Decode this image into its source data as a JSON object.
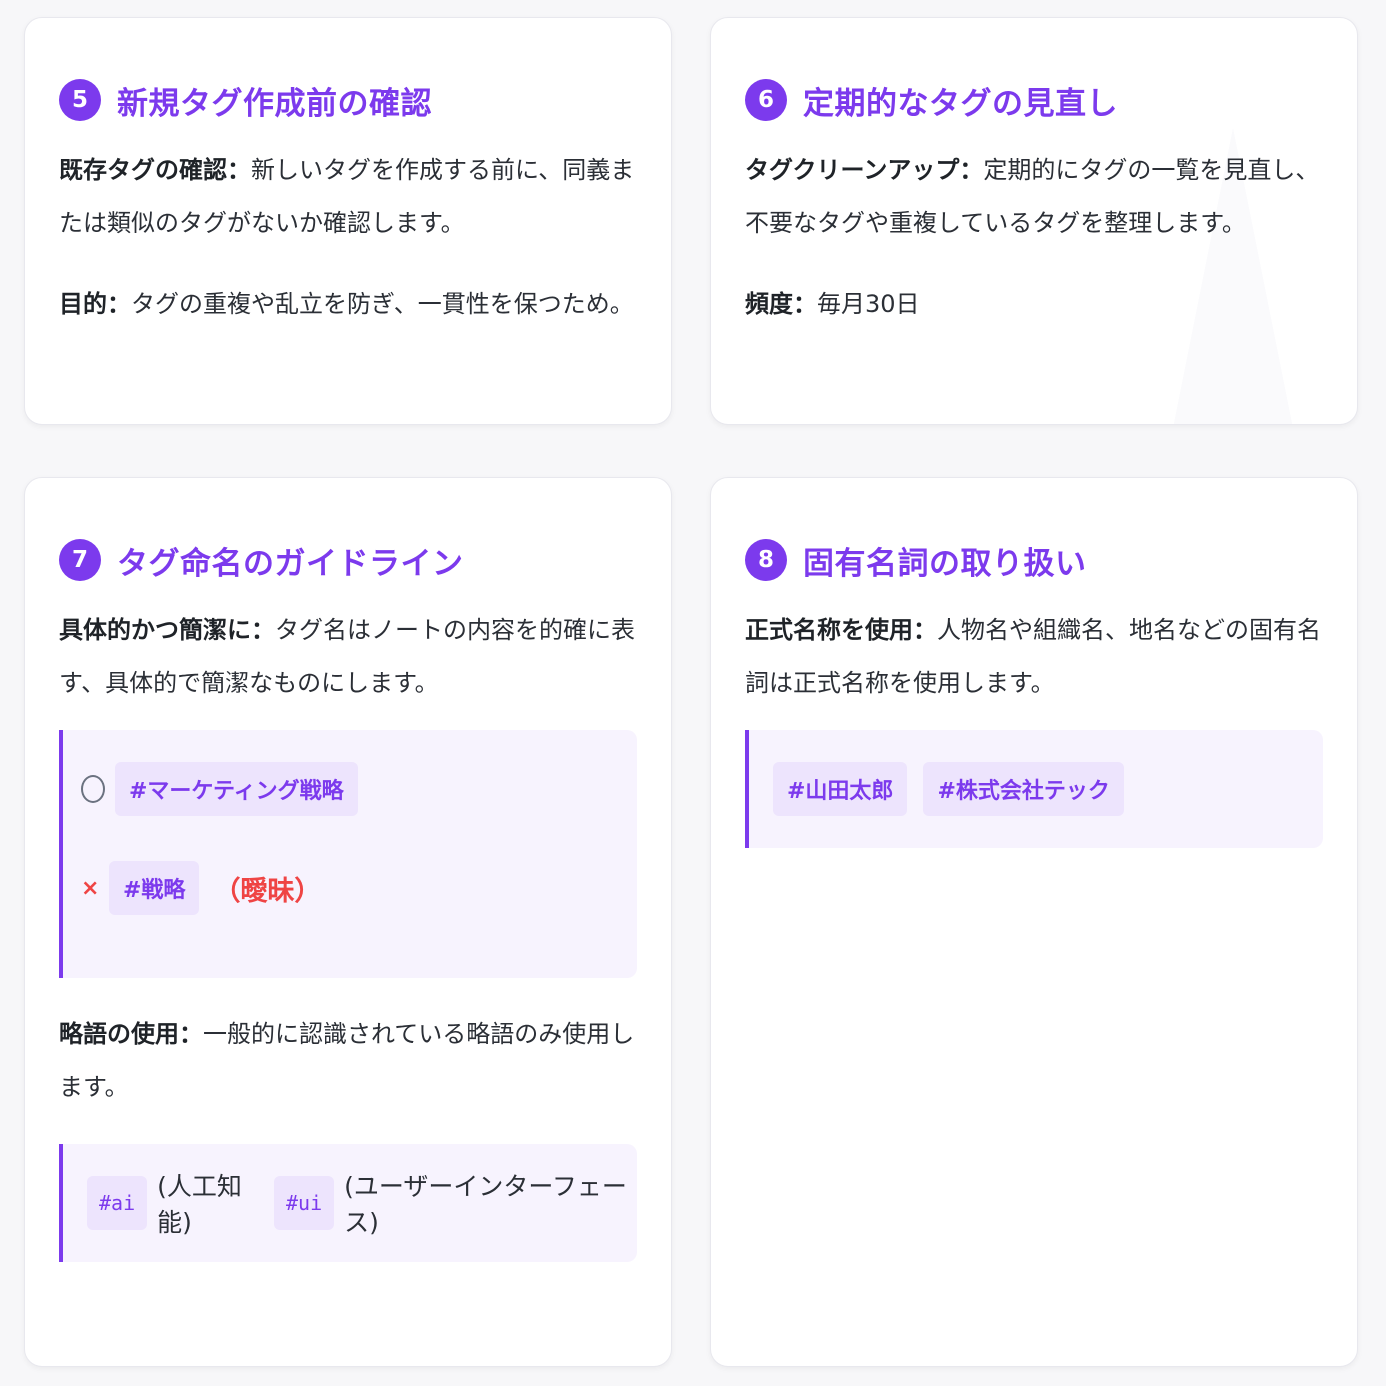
{
  "cards": [
    {
      "number": "5",
      "title": "新規タグ作成前の確認",
      "p1_label": "既存タグの確認：",
      "p1_text": "新しいタグを作成する前に、同義または類似のタグがないか確認します。",
      "p2_label": "目的：",
      "p2_text": "タグの重複や乱立を防ぎ、一貫性を保つため。"
    },
    {
      "number": "6",
      "title": "定期的なタグの見直し",
      "p1_label": "タグクリーンアップ：",
      "p1_text": "定期的にタグの一覧を見直し、不要なタグや重複しているタグを整理します。",
      "p2_label": "頻度：",
      "p2_text": "毎月30日"
    },
    {
      "number": "7",
      "title": "タグ命名のガイドライン",
      "p1_label": "具体的かつ簡潔に：",
      "p1_text": "タグ名はノートの内容を的確に表す、具体的で簡潔なものにします。",
      "good_tag": "#マーケティング戦略",
      "bad_tag": "#戦略",
      "bad_note": "（曖昧）",
      "p2_label": "略語の使用：",
      "p2_text": "一般的に認識されている略語のみ使用します。",
      "abbr": [
        {
          "tag": "#ai",
          "meaning": "(人工知能)"
        },
        {
          "tag": "#ui",
          "meaning": "(ユーザーインターフェース)"
        }
      ]
    },
    {
      "number": "8",
      "title": "固有名詞の取り扱い",
      "p1_label": "正式名称を使用：",
      "p1_text": "人物名や組織名、地名などの固有名詞は正式名称を使用します。",
      "tags": [
        "#山田太郎",
        "#株式会社テック"
      ]
    }
  ],
  "colors": {
    "accent": "#7c3aed",
    "error": "#ef4444",
    "tag_bg": "#ede4fd",
    "example_bg": "#f7f3fe"
  },
  "icons": {
    "good": "circle-icon",
    "bad": "cross-icon"
  }
}
